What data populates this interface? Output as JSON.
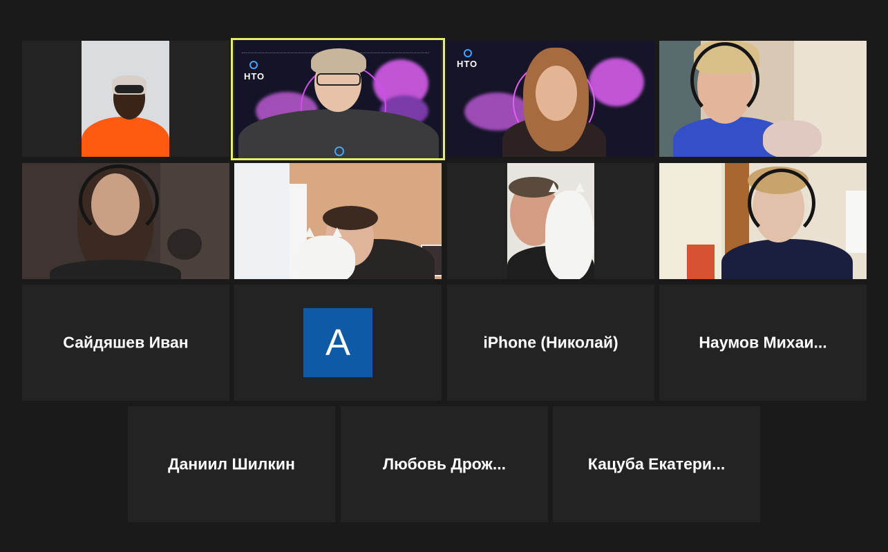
{
  "participants": {
    "name_tiles": [
      {
        "name": "Сайдяшев Иван"
      },
      {
        "initial": "A"
      },
      {
        "name": "iPhone (Николай)"
      },
      {
        "name": "Наумов  Михаи..."
      },
      {
        "name": "Даниил Шилкин"
      },
      {
        "name": "Любовь  Дрож..."
      },
      {
        "name": "Кацуба  Екатери..."
      }
    ],
    "nto_logo_text": "НТО"
  },
  "colors": {
    "background": "#1a1a1a",
    "tile": "#232323",
    "active_speaker_border": "#e9ee6a",
    "avatar": "#0e5aa7"
  }
}
